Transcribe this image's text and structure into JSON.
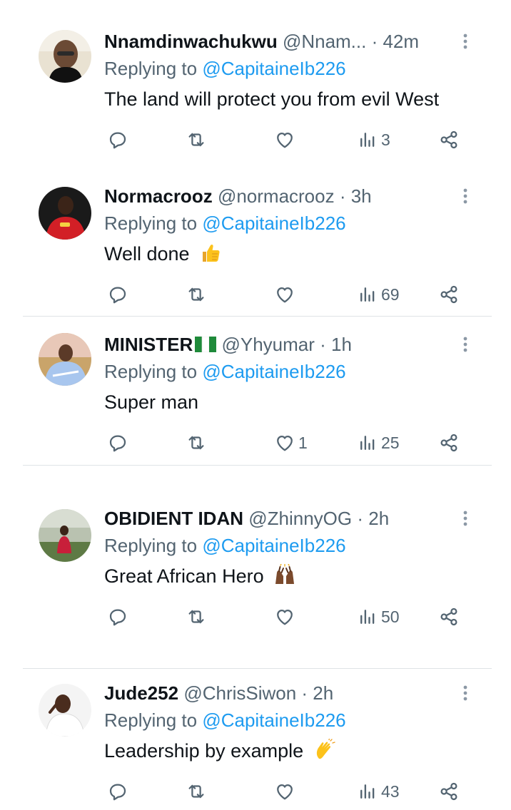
{
  "colors": {
    "text": "#0f1419",
    "secondary": "#536471",
    "link": "#1d9bf0",
    "divider": "#dfe3e6"
  },
  "replies": [
    {
      "display_name": "Nnamdinwachukwu",
      "handle": "@Nnam...",
      "time": " · 42m",
      "replying_prefix": "Replying to ",
      "replying_to": "@CapitaineIb226",
      "text": "The land will protect you from evil West",
      "emoji": "",
      "likes": "",
      "views": "3"
    },
    {
      "display_name": "Normacrooz",
      "handle": "@normacrooz",
      "time": " · 3h",
      "replying_prefix": "Replying to ",
      "replying_to": "@CapitaineIb226",
      "text": "Well done ",
      "emoji": "thumbs-up",
      "likes": "",
      "views": "69"
    },
    {
      "display_name": "MINISTER",
      "name_flag": "nigeria-flag",
      "handle": "@Yhyumar",
      "time": " · 1h",
      "replying_prefix": "Replying to ",
      "replying_to": "@CapitaineIb226",
      "text": "Super man",
      "emoji": "",
      "likes": "1",
      "views": "25"
    },
    {
      "display_name": "OBIDIENT IDAN",
      "handle": "@ZhinnyOG",
      "time": " · 2h",
      "replying_prefix": "Replying to ",
      "replying_to": "@CapitaineIb226",
      "text": "Great African Hero ",
      "emoji": "raising-hands",
      "likes": "",
      "views": "50"
    },
    {
      "display_name": "Jude252",
      "handle": "@ChrisSiwon",
      "time": " · 2h",
      "replying_prefix": "Replying to ",
      "replying_to": "@CapitaineIb226",
      "text": "Leadership by example ",
      "emoji": "clapping-hands",
      "likes": "",
      "views": "43"
    }
  ],
  "icons": {
    "reply": "reply-icon",
    "retweet": "retweet-icon",
    "like": "heart-icon",
    "views": "views-icon",
    "share": "share-icon",
    "more": "more-icon"
  }
}
